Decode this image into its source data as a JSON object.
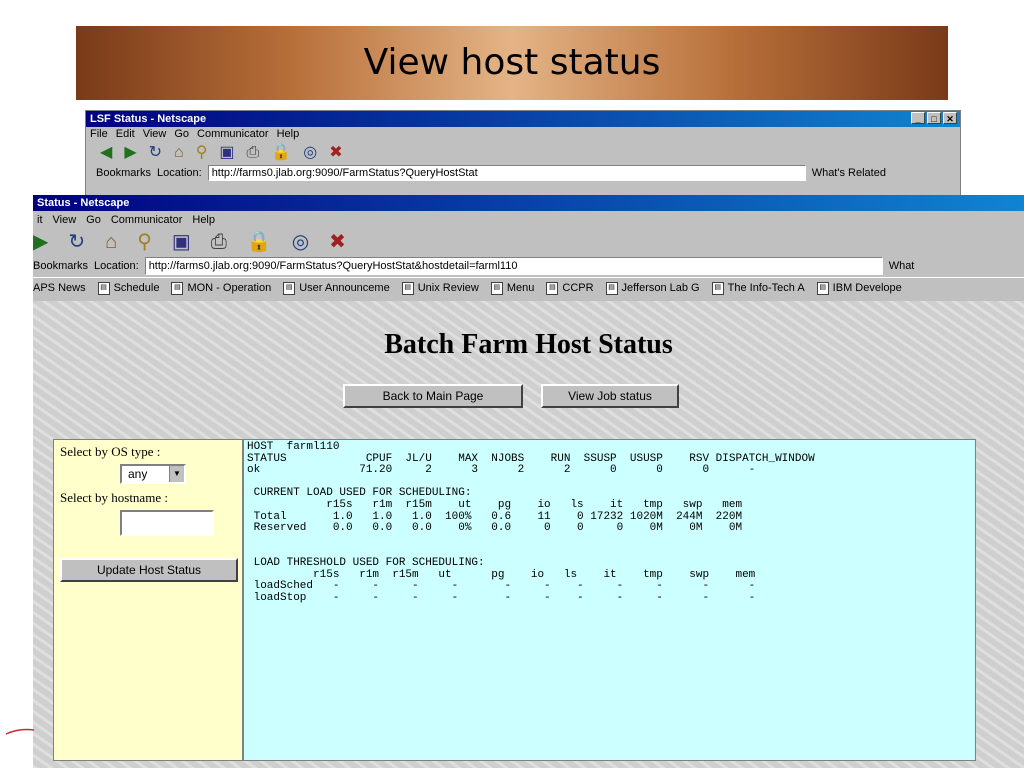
{
  "slide": {
    "title": "View host status"
  },
  "back_window": {
    "title": "LSF Status - Netscape",
    "menu": [
      "File",
      "Edit",
      "View",
      "Go",
      "Communicator",
      "Help"
    ],
    "bookmarks_label": "Bookmarks",
    "location_label": "Location:",
    "url": "http://farms0.jlab.org:9090/FarmStatus?QueryHostStat",
    "whats_related": "What's Related"
  },
  "front_window": {
    "title": "Status - Netscape",
    "menu": [
      "it",
      "View",
      "Go",
      "Communicator",
      "Help"
    ],
    "bookmarks_label": "Bookmarks",
    "location_label": "Location:",
    "url": "http://farms0.jlab.org:9090/FarmStatus?QueryHostStat&hostdetail=farml110",
    "whats_related": "What",
    "links": [
      "APS News",
      "Schedule",
      "MON - Operation",
      "User Announceme",
      "Unix Review",
      "Menu",
      "CCPR",
      "Jefferson Lab G",
      "The Info-Tech A",
      "IBM Develope"
    ]
  },
  "page": {
    "heading": "Batch Farm Host Status",
    "back_button": "Back to Main Page",
    "job_button": "View Job status",
    "os_label": "Select by OS type :",
    "os_value": "any",
    "hostname_label": "Select by hostname :",
    "hostname_value": "",
    "update_button": "Update Host Status",
    "host_output": "HOST  farml110\nSTATUS            CPUF  JL/U    MAX  NJOBS    RUN  SSUSP  USUSP    RSV DISPATCH_WINDOW\nok               71.20     2      3      2      2      0      0      0      -\n\n CURRENT LOAD USED FOR SCHEDULING:\n            r15s   r1m  r15m    ut    pg    io   ls    it   tmp   swp   mem\n Total       1.0   1.0   1.0  100%   0.6    11    0 17232 1020M  244M  220M\n Reserved    0.0   0.0   0.0    0%   0.0     0    0     0    0M    0M    0M\n\n\n LOAD THRESHOLD USED FOR SCHEDULING:\n          r15s   r1m  r15m   ut      pg    io   ls    it    tmp    swp    mem\n loadSched   -     -     -     -       -     -    -     -     -      -      -\n loadStop    -     -     -     -       -     -    -     -     -      -      -"
  },
  "colors": {
    "left_panel_bg": "#ffffcc",
    "right_panel_bg": "#ccffff",
    "caption_bg": "#000080",
    "title_bar_brown": "#b8703a"
  }
}
